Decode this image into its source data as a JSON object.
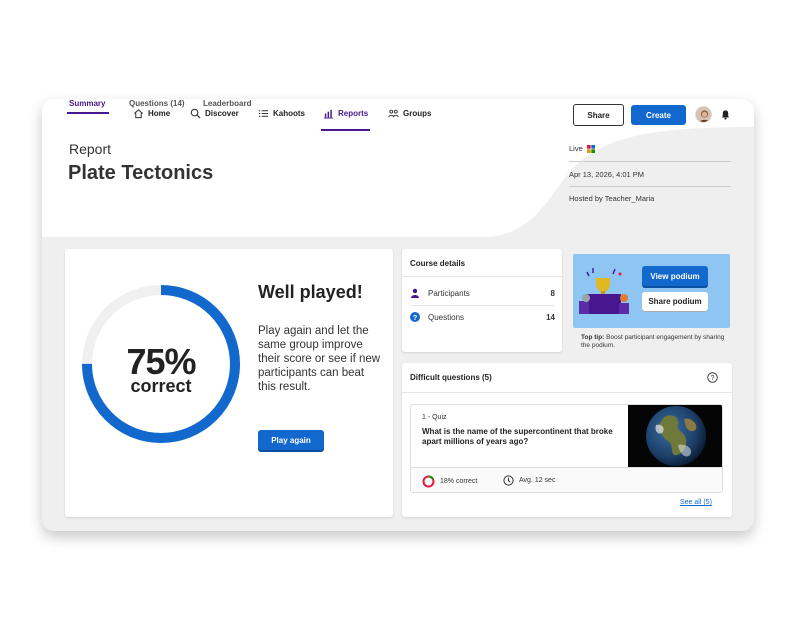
{
  "nav": {
    "items": [
      {
        "label": "Home",
        "icon": "home-icon",
        "active": false
      },
      {
        "label": "Discover",
        "icon": "search-icon",
        "active": false
      },
      {
        "label": "Kahoots",
        "icon": "list-icon",
        "active": false
      },
      {
        "label": "Reports",
        "icon": "bar-chart-icon",
        "active": true
      },
      {
        "label": "Groups",
        "icon": "people-icon",
        "active": false
      }
    ],
    "share_label": "Share",
    "create_label": "Create"
  },
  "header": {
    "section": "Report",
    "title": "Plate Tectonics",
    "tabs": [
      "Summary",
      "Questions (14)",
      "Leaderboard"
    ],
    "meta": {
      "live": "Live",
      "date": "Apr 13, 2026, 4:01 PM",
      "host": "Hosted by Teacher_Maria"
    }
  },
  "score": {
    "percent_text": "75%",
    "percent_value": 0.75,
    "correct_label": "correct",
    "headline": "Well played!",
    "message": "Play again and let the same group improve their score or see if new participants can beat this result.",
    "play_again_label": "Play again"
  },
  "course": {
    "title": "Course details",
    "rows": [
      {
        "label": "Participants",
        "value": "8",
        "icon": "participant-icon"
      },
      {
        "label": "Questions",
        "value": "14",
        "icon": "question-icon"
      }
    ]
  },
  "podium": {
    "view_label": "View podium",
    "share_label": "Share podium",
    "tip_bold": "Top tip:",
    "tip_text": "Boost participant engagement by sharing the podium."
  },
  "difficult": {
    "title": "Difficult questions (5)",
    "question": {
      "type": "1 - Quiz",
      "text": "What is the name of the supercontinent that broke apart millions of years ago?",
      "correct_text": "18% correct",
      "correct_value": 0.18,
      "time_text": "Avg. 12 sec"
    },
    "see_all": "See all (5)"
  },
  "colors": {
    "brand_purple": "#46178f",
    "primary_blue": "#1368ce",
    "ring_blue": "#1368ce",
    "correct_green": "#26890c",
    "wrong_red": "#e21b3c"
  }
}
